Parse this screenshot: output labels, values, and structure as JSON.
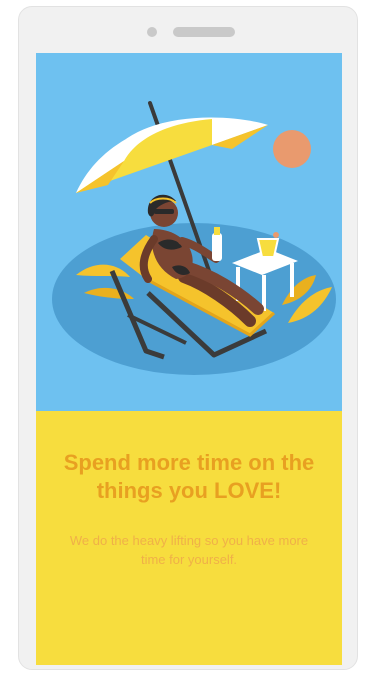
{
  "hero": {
    "illustration": "woman-relaxing-on-sun-lounger-under-umbrella"
  },
  "copy": {
    "headline": "Spend more time on the things you LOVE!",
    "subtext": "We do the heavy lifting so you have more time for yourself."
  },
  "colors": {
    "sky": "#6ec1f0",
    "sun": "#e99a6e",
    "panel": "#f7dd3e",
    "headline": "#e8a021",
    "subtext": "#f0b048"
  }
}
